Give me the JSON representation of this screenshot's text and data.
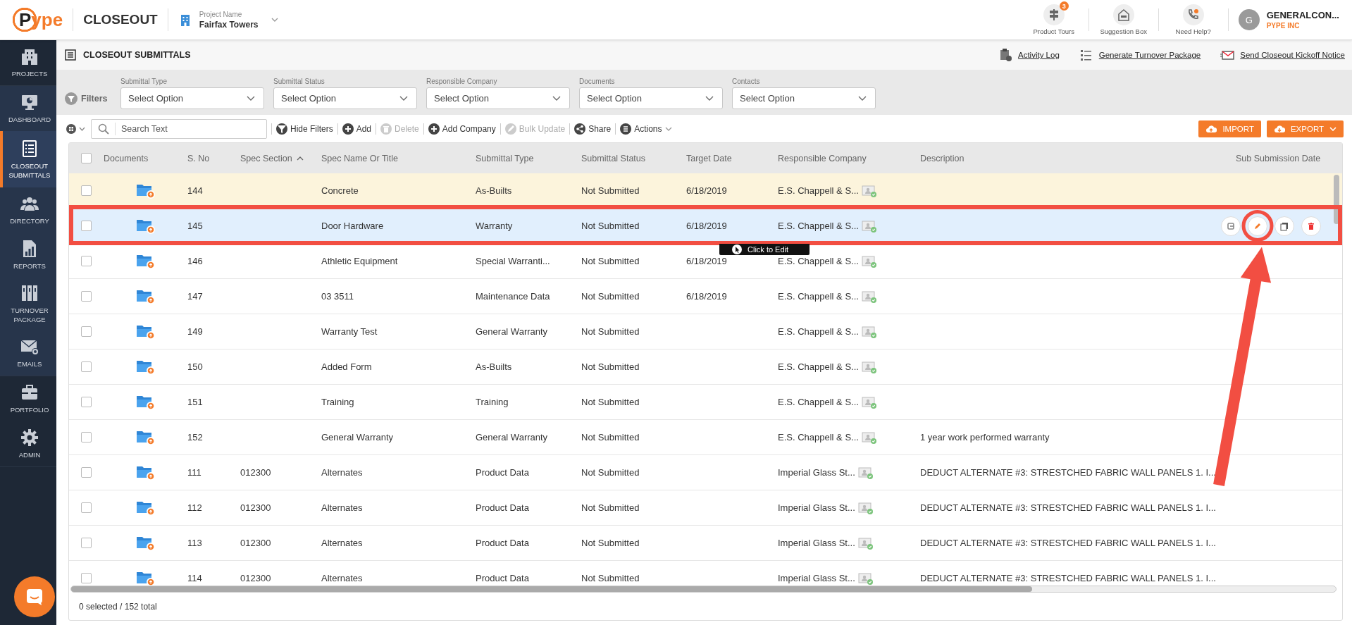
{
  "top_bar": {
    "logo": "Pype",
    "app_name": "CLOSEOUT",
    "project": {
      "label": "Project Name",
      "value": "Fairfax Towers"
    },
    "tools": [
      {
        "label": "Product Tours",
        "badge": "3"
      },
      {
        "label": "Suggestion Box"
      },
      {
        "label": "Need Help?"
      }
    ],
    "user": {
      "avatar": "G",
      "name": "GENERALCON...",
      "company": "PYPE INC"
    }
  },
  "sidebar": {
    "groups": [
      {
        "items": [
          {
            "label": "PROJECTS",
            "selected": false
          }
        ]
      },
      {
        "items": [
          {
            "label": "DASHBOARD",
            "selected": false
          },
          {
            "label": "CLOSEOUT SUBMITTALS",
            "selected": true
          },
          {
            "label": "DIRECTORY",
            "selected": false
          },
          {
            "label": "REPORTS",
            "selected": false
          },
          {
            "label": "TURNOVER PACKAGE",
            "selected": false
          },
          {
            "label": "EMAILS",
            "selected": false
          }
        ]
      },
      {
        "items": [
          {
            "label": "PORTFOLIO",
            "selected": false
          },
          {
            "label": "ADMIN",
            "selected": false
          }
        ]
      }
    ]
  },
  "page": {
    "title": "CLOSEOUT SUBMITTALS",
    "links": [
      "Activity Log",
      "Generate Turnover Package",
      "Send Closeout Kickoff Notice"
    ]
  },
  "filters": {
    "label": "Filters",
    "fields": [
      {
        "label": "Submittal Type",
        "placeholder": "Select Option"
      },
      {
        "label": "Submittal Status",
        "placeholder": "Select Option"
      },
      {
        "label": "Responsible Company",
        "placeholder": "Select Option"
      },
      {
        "label": "Documents",
        "placeholder": "Select Option"
      },
      {
        "label": "Contacts",
        "placeholder": "Select Option"
      }
    ]
  },
  "toolbar": {
    "search": {
      "placeholder": "Search Text"
    },
    "actions": [
      {
        "label": "Hide Filters",
        "disabled": false,
        "dropdown": false
      },
      {
        "label": "Add",
        "disabled": false,
        "dropdown": false
      },
      {
        "label": "Delete",
        "disabled": true,
        "dropdown": false
      },
      {
        "label": "Add Company",
        "disabled": false,
        "dropdown": false
      },
      {
        "label": "Bulk Update",
        "disabled": true,
        "dropdown": false
      },
      {
        "label": "Share",
        "disabled": false,
        "dropdown": false
      },
      {
        "label": "Actions",
        "disabled": false,
        "dropdown": true
      }
    ],
    "import": "IMPORT",
    "export": "EXPORT"
  },
  "table": {
    "select_all": {
      "checked": false
    },
    "columns": [
      {
        "label": "Documents",
        "sorted": false
      },
      {
        "label": "S. No",
        "sorted": false
      },
      {
        "label": "Spec Section",
        "sorted": true
      },
      {
        "label": "Spec Name Or Title",
        "sorted": false
      },
      {
        "label": "Submittal Type",
        "sorted": false
      },
      {
        "label": "Submittal Status",
        "sorted": false
      },
      {
        "label": "Target Date",
        "sorted": false
      },
      {
        "label": "Responsible Company",
        "sorted": false
      },
      {
        "label": "Description",
        "sorted": false
      },
      {
        "label": "Sub Submission Date",
        "sorted": false
      }
    ],
    "rows": [
      {
        "checked": false,
        "highlighted": true,
        "hovered": false,
        "s_no": "144",
        "spec_name": "Concrete",
        "type": "As-Builts",
        "status": "Not Submitted",
        "target_date": "6/18/2019",
        "company": "E.S. Chappell & S..."
      },
      {
        "checked": false,
        "highlighted": false,
        "hovered": true,
        "s_no": "145",
        "spec_name": "Door Hardware",
        "type": "Warranty",
        "status": "Not Submitted",
        "target_date": "6/18/2019",
        "company": "E.S. Chappell & S...",
        "tooltip": "Click to Edit"
      },
      {
        "checked": false,
        "highlighted": false,
        "hovered": false,
        "s_no": "146",
        "spec_name": "Athletic Equipment",
        "type": "Special Warranti...",
        "status": "Not Submitted",
        "target_date": "6/18/2019",
        "company": "E.S. Chappell & S..."
      },
      {
        "checked": false,
        "highlighted": false,
        "hovered": false,
        "s_no": "147",
        "spec_name": "03 3511",
        "type": "Maintenance Data",
        "status": "Not Submitted",
        "target_date": "6/18/2019",
        "company": "E.S. Chappell & S..."
      },
      {
        "checked": false,
        "highlighted": false,
        "hovered": false,
        "s_no": "149",
        "spec_name": "Warranty Test",
        "type": "General Warranty",
        "status": "Not Submitted",
        "company": "E.S. Chappell & S..."
      },
      {
        "checked": false,
        "highlighted": false,
        "hovered": false,
        "s_no": "150",
        "spec_name": "Added Form",
        "type": "As-Builts",
        "status": "Not Submitted",
        "company": "E.S. Chappell & S..."
      },
      {
        "checked": false,
        "highlighted": false,
        "hovered": false,
        "s_no": "151",
        "spec_name": "Training",
        "type": "Training",
        "status": "Not Submitted",
        "company": "E.S. Chappell & S..."
      },
      {
        "checked": false,
        "highlighted": false,
        "hovered": false,
        "s_no": "152",
        "spec_name": "General Warranty",
        "type": "General Warranty",
        "status": "Not Submitted",
        "company": "E.S. Chappell & S...",
        "description": "1 year work performed warranty"
      },
      {
        "checked": false,
        "highlighted": false,
        "hovered": false,
        "s_no": "111",
        "spec_section": "012300",
        "spec_name": "Alternates",
        "type": "Product Data",
        "status": "Not Submitted",
        "company": "Imperial Glass St...",
        "description": "DEDUCT ALTERNATE #3: STRESTCHED FABRIC WALL PANELS 1. I..."
      },
      {
        "checked": false,
        "highlighted": false,
        "hovered": false,
        "s_no": "112",
        "spec_section": "012300",
        "spec_name": "Alternates",
        "type": "Product Data",
        "status": "Not Submitted",
        "company": "Imperial Glass St...",
        "description": "DEDUCT ALTERNATE #3: STRESTCHED FABRIC WALL PANELS 1. I..."
      },
      {
        "checked": false,
        "highlighted": false,
        "hovered": false,
        "s_no": "113",
        "spec_section": "012300",
        "spec_name": "Alternates",
        "type": "Product Data",
        "status": "Not Submitted",
        "company": "Imperial Glass St...",
        "description": "DEDUCT ALTERNATE #3: STRESTCHED FABRIC WALL PANELS 1. I..."
      },
      {
        "checked": false,
        "highlighted": false,
        "hovered": false,
        "s_no": "114",
        "spec_section": "012300",
        "spec_name": "Alternates",
        "type": "Product Data",
        "status": "Not Submitted",
        "company": "Imperial Glass St...",
        "description": "DEDUCT ALTERNATE #3: STRESTCHED FABRIC WALL PANELS 1. I..."
      }
    ],
    "footer": "0 selected / 152 total"
  }
}
